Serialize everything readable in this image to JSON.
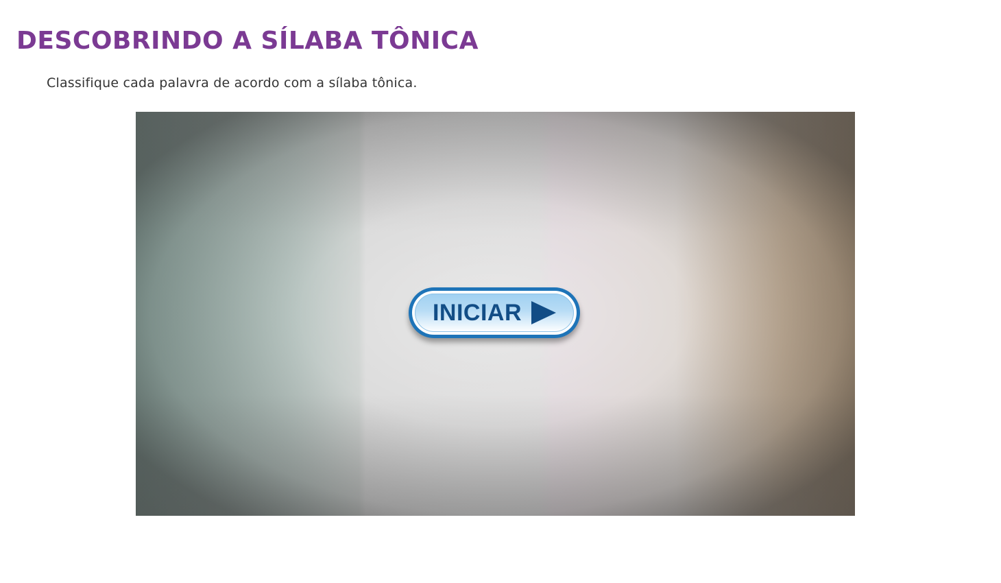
{
  "header": {
    "title": "DESCOBRINDO A SÍLABA TÔNICA",
    "instruction": "Classifique cada palavra de acordo com a sílaba tônica."
  },
  "activity": {
    "start_button": {
      "label": "INICIAR",
      "icon": "play-icon"
    }
  },
  "colors": {
    "title": "#7b3a93",
    "button_border": "#1e74b8",
    "button_text": "#124d86"
  }
}
